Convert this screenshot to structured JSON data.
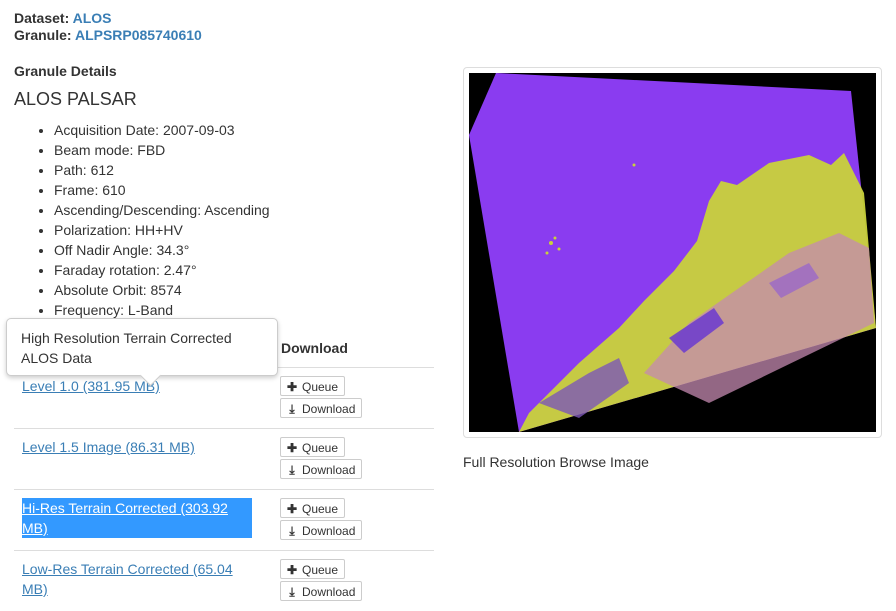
{
  "header": {
    "dataset_label": "Dataset:",
    "dataset_value": "ALOS",
    "granule_label": "Granule:",
    "granule_value": "ALPSRP085740610"
  },
  "details": {
    "section_title": "Granule Details",
    "mission": "ALOS PALSAR",
    "items": [
      "Acquisition Date: 2007-09-03",
      "Beam mode: FBD",
      "Path: 612",
      "Frame: 610",
      "Ascending/Descending: Ascending",
      "Polarization: HH+HV",
      "Off Nadir Angle: 34.3°",
      "Faraday rotation: 2.47°",
      "Absolute Orbit: 8574",
      "Frequency: L-Band"
    ]
  },
  "downloads": {
    "column_header": "Download",
    "queue_label": "Queue",
    "download_label": "Download",
    "queue_icon": "plus-icon",
    "download_icon": "download-icon",
    "products": [
      {
        "label": "Level 1.0 (381.95 MB)"
      },
      {
        "label": "Level 1.5 Image (86.31 MB)"
      },
      {
        "label": "Hi-Res Terrain Corrected (303.92 MB)"
      },
      {
        "label": "Low-Res Terrain Corrected (65.04 MB)"
      }
    ]
  },
  "tooltip": {
    "text": "High Resolution Terrain Corrected ALOS Data"
  },
  "browse": {
    "caption": "Full Resolution Browse Image"
  },
  "colors": {
    "link": "#3a7eb5",
    "selection": "#3399ff",
    "water": "#8a3cf0",
    "land": "#c9d23a"
  }
}
